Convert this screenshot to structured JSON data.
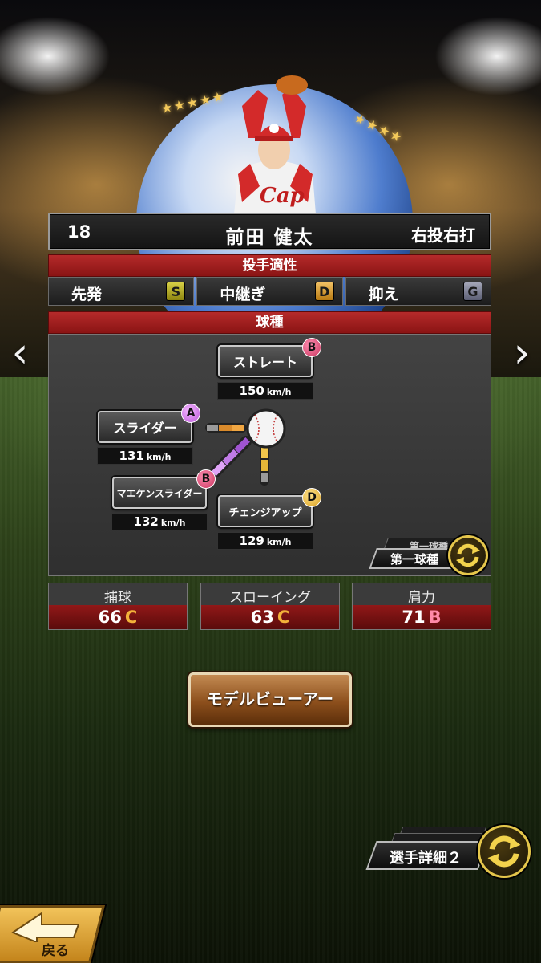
{
  "player": {
    "number": "18",
    "name": "前田 健太",
    "handedness": "右投右打"
  },
  "aptitude": {
    "title": "投手適性",
    "items": [
      {
        "label": "先発",
        "grade": "S"
      },
      {
        "label": "中継ぎ",
        "grade": "D"
      },
      {
        "label": "抑え",
        "grade": "G"
      }
    ]
  },
  "pitches": {
    "title": "球種",
    "unit": "km/h",
    "straight": {
      "name": "ストレート",
      "grade": "B",
      "speed": "150"
    },
    "slider": {
      "name": "スライダー",
      "grade": "A",
      "speed": "131"
    },
    "maeken_slider": {
      "name": "マエケンスライダー",
      "grade": "B",
      "speed": "132"
    },
    "changeup": {
      "name": "チェンジアップ",
      "grade": "D",
      "speed": "129"
    },
    "first_pitch_label": "第一球種",
    "first_pitch_back_label": "第一球種"
  },
  "fielding": [
    {
      "label": "捕球",
      "value": "66",
      "rank": "C"
    },
    {
      "label": "スローイング",
      "value": "63",
      "rank": "C"
    },
    {
      "label": "肩力",
      "value": "71",
      "rank": "B"
    }
  ],
  "buttons": {
    "model_viewer": "モデルビューアー",
    "player_detail": "選手詳細２",
    "back": "戻る"
  },
  "icons": {
    "prev": "chevron-left-icon",
    "next": "chevron-right-icon",
    "swap": "swap-cycle-icon"
  },
  "colors": {
    "accent_red": "#8a1414",
    "rank_c": "#f3b23a",
    "rank_b": "#ff8aa8",
    "gold": "#e5c64b"
  }
}
